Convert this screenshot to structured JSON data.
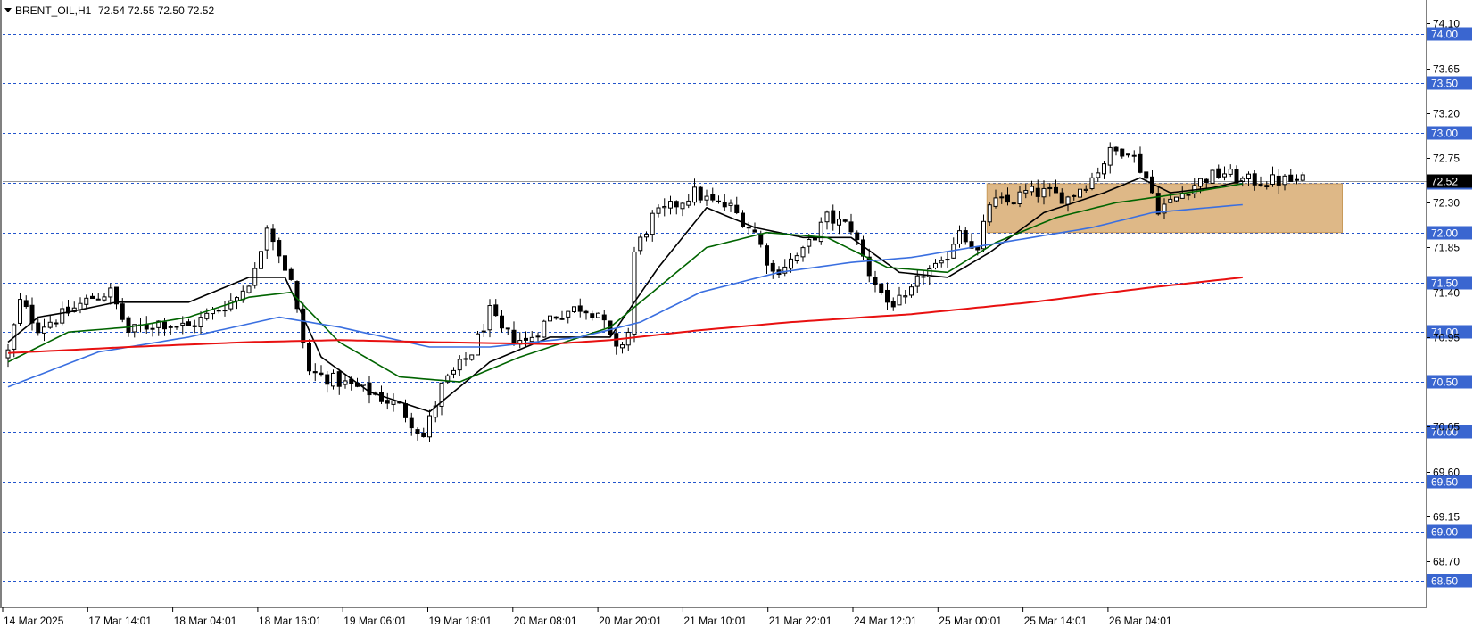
{
  "header": {
    "collapse_icon": "triangle-down-icon",
    "symbol": "BRENT_OIL,H1",
    "ohlc": "72.54 72.55 72.50 72.52"
  },
  "colors": {
    "up_candle": "#ffffff",
    "down_candle": "#000000",
    "grid_level": "#2255cc",
    "price_badge": "#3a66d0",
    "zone": "#deb887",
    "ma_fast": "#000000",
    "ma_mid": "#006400",
    "ma_slow": "#3a6fe0",
    "ma_long": "#e81010"
  },
  "chart_data": {
    "type": "candlestick",
    "symbol": "BRENT_OIL",
    "timeframe": "H1",
    "last_price": "72.52",
    "ylim": [
      68.38,
      74.38
    ],
    "y_ticks": [
      "74.10",
      "73.65",
      "73.20",
      "72.75",
      "72.30",
      "71.85",
      "71.40",
      "70.95",
      "70.05",
      "69.60",
      "69.15",
      "68.70"
    ],
    "level_lines": [
      "74.00",
      "73.50",
      "73.00",
      "72.50",
      "72.00",
      "71.50",
      "71.00",
      "70.50",
      "70.00",
      "69.50",
      "69.00",
      "68.50"
    ],
    "x_labels": [
      "14 Mar 2025",
      "17 Mar 14:01",
      "18 Mar 04:01",
      "18 Mar 16:01",
      "19 Mar 06:01",
      "19 Mar 18:01",
      "20 Mar 08:01",
      "20 Mar 20:01",
      "21 Mar 10:01",
      "21 Mar 22:01",
      "24 Mar 12:01",
      "25 Mar 00:01",
      "25 Mar 14:01",
      "26 Mar 04:01"
    ],
    "bars": 216,
    "zone": {
      "start_bar": 163,
      "end_bar": 222,
      "price_high": 72.49,
      "price_low": 72.0
    },
    "close_anchors": [
      [
        0,
        70.8
      ],
      [
        2,
        71.3
      ],
      [
        5,
        71.05
      ],
      [
        10,
        71.2
      ],
      [
        14,
        71.35
      ],
      [
        17,
        71.4
      ],
      [
        20,
        71.0
      ],
      [
        25,
        71.1
      ],
      [
        30,
        71.05
      ],
      [
        34,
        71.2
      ],
      [
        38,
        71.35
      ],
      [
        41,
        71.6
      ],
      [
        43,
        72.1
      ],
      [
        45,
        71.8
      ],
      [
        47,
        71.5
      ],
      [
        50,
        70.6
      ],
      [
        55,
        70.5
      ],
      [
        60,
        70.4
      ],
      [
        65,
        70.25
      ],
      [
        69,
        69.95
      ],
      [
        72,
        70.45
      ],
      [
        77,
        70.8
      ],
      [
        80,
        71.2
      ],
      [
        82,
        71.0
      ],
      [
        86,
        70.9
      ],
      [
        90,
        71.15
      ],
      [
        95,
        71.25
      ],
      [
        98,
        71.2
      ],
      [
        101,
        70.8
      ],
      [
        103,
        71.0
      ],
      [
        104,
        71.8
      ],
      [
        107,
        72.15
      ],
      [
        110,
        72.25
      ],
      [
        114,
        72.4
      ],
      [
        117,
        72.3
      ],
      [
        120,
        72.25
      ],
      [
        124,
        72.0
      ],
      [
        127,
        71.6
      ],
      [
        132,
        71.8
      ],
      [
        136,
        72.15
      ],
      [
        140,
        72.05
      ],
      [
        143,
        71.6
      ],
      [
        146,
        71.3
      ],
      [
        149,
        71.3
      ],
      [
        152,
        71.6
      ],
      [
        155,
        71.65
      ],
      [
        158,
        72.05
      ],
      [
        161,
        71.8
      ],
      [
        163,
        72.3
      ],
      [
        166,
        72.3
      ],
      [
        169,
        72.4
      ],
      [
        172,
        72.4
      ],
      [
        176,
        72.35
      ],
      [
        180,
        72.55
      ],
      [
        183,
        72.8
      ],
      [
        186,
        72.85
      ],
      [
        189,
        72.55
      ],
      [
        191,
        72.25
      ],
      [
        193,
        72.3
      ],
      [
        196,
        72.45
      ],
      [
        199,
        72.55
      ],
      [
        202,
        72.6
      ],
      [
        205,
        72.52
      ]
    ],
    "ma_series": [
      {
        "period": 5,
        "values_at_bars": [
          [
            0,
            70.9
          ],
          [
            5,
            71.15
          ],
          [
            10,
            71.2
          ],
          [
            18,
            71.3
          ],
          [
            30,
            71.3
          ],
          [
            40,
            71.55
          ],
          [
            46,
            71.55
          ],
          [
            52,
            70.75
          ],
          [
            60,
            70.4
          ],
          [
            70,
            70.2
          ],
          [
            80,
            70.7
          ],
          [
            90,
            70.95
          ],
          [
            100,
            70.95
          ],
          [
            108,
            71.65
          ],
          [
            116,
            72.25
          ],
          [
            124,
            72.05
          ],
          [
            132,
            71.95
          ],
          [
            140,
            71.95
          ],
          [
            148,
            71.6
          ],
          [
            156,
            71.55
          ],
          [
            163,
            71.8
          ],
          [
            172,
            72.2
          ],
          [
            182,
            72.4
          ],
          [
            188,
            72.55
          ],
          [
            193,
            72.4
          ],
          [
            200,
            72.45
          ],
          [
            205,
            72.52
          ]
        ]
      },
      {
        "period": 13,
        "values_at_bars": [
          [
            0,
            70.7
          ],
          [
            10,
            71.0
          ],
          [
            20,
            71.05
          ],
          [
            30,
            71.15
          ],
          [
            40,
            71.35
          ],
          [
            47,
            71.4
          ],
          [
            55,
            70.9
          ],
          [
            65,
            70.55
          ],
          [
            75,
            70.5
          ],
          [
            85,
            70.75
          ],
          [
            100,
            71.05
          ],
          [
            108,
            71.45
          ],
          [
            116,
            71.85
          ],
          [
            126,
            72.0
          ],
          [
            136,
            71.95
          ],
          [
            146,
            71.65
          ],
          [
            156,
            71.6
          ],
          [
            164,
            71.9
          ],
          [
            174,
            72.15
          ],
          [
            184,
            72.3
          ],
          [
            190,
            72.35
          ],
          [
            198,
            72.42
          ],
          [
            205,
            72.49
          ]
        ]
      },
      {
        "period": 34,
        "values_at_bars": [
          [
            0,
            70.45
          ],
          [
            15,
            70.8
          ],
          [
            30,
            70.95
          ],
          [
            45,
            71.15
          ],
          [
            55,
            71.05
          ],
          [
            70,
            70.85
          ],
          [
            80,
            70.85
          ],
          [
            95,
            70.95
          ],
          [
            105,
            71.1
          ],
          [
            115,
            71.4
          ],
          [
            128,
            71.6
          ],
          [
            140,
            71.7
          ],
          [
            150,
            71.75
          ],
          [
            165,
            71.9
          ],
          [
            180,
            72.05
          ],
          [
            190,
            72.2
          ],
          [
            205,
            72.28
          ]
        ]
      },
      {
        "period": 144,
        "values_at_bars": [
          [
            0,
            70.79
          ],
          [
            20,
            70.85
          ],
          [
            40,
            70.9
          ],
          [
            55,
            70.92
          ],
          [
            70,
            70.9
          ],
          [
            90,
            70.88
          ],
          [
            100,
            70.92
          ],
          [
            115,
            71.02
          ],
          [
            130,
            71.1
          ],
          [
            150,
            71.18
          ],
          [
            170,
            71.3
          ],
          [
            190,
            71.45
          ],
          [
            205,
            71.55
          ]
        ]
      }
    ]
  }
}
